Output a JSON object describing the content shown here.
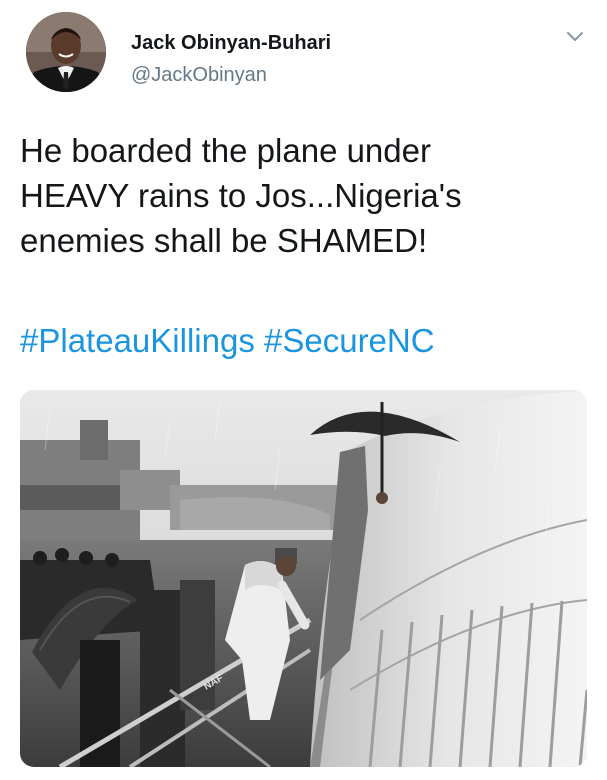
{
  "author": {
    "display_name": "Jack Obinyan-Buhari",
    "handle": "@JackObinyan"
  },
  "tweet": {
    "text_lines": [
      "He boarded the plane under",
      "HEAVY rains to Jos...Nigeria's",
      "enemies shall be SHAMED!"
    ],
    "hashtags": [
      "#PlateauKillings",
      "#SecureNC"
    ]
  },
  "photo": {
    "fuselage_lettering": "NAF"
  },
  "colors": {
    "hashtag_blue": "#1b95e0",
    "handle_gray": "#657786",
    "text_dark": "#14171a"
  },
  "icons": {
    "menu": "chevron-down-icon"
  }
}
